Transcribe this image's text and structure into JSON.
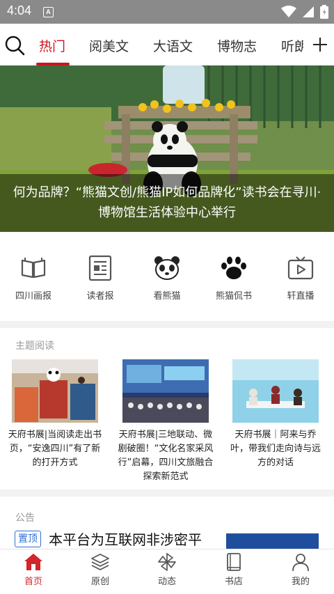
{
  "status_bar": {
    "time": "4:04",
    "notification_letter": "A"
  },
  "top_nav": {
    "tabs": [
      {
        "label": "热门",
        "active": true
      },
      {
        "label": "阅美文"
      },
      {
        "label": "大语文"
      },
      {
        "label": "博物志"
      },
      {
        "label": "听朗"
      }
    ],
    "accent_color": "#c8161d"
  },
  "banner": {
    "caption_line1": "何为品牌？“熊猫文创/熊猫IP如何品牌化”读书会在寻川·",
    "caption_line2": "博物馆生活体验中心举行"
  },
  "quick_links": [
    {
      "label": "四川画报",
      "icon": "open-book-icon"
    },
    {
      "label": "读者报",
      "icon": "newspaper-icon"
    },
    {
      "label": "看熊猫",
      "icon": "panda-face-icon"
    },
    {
      "label": "熊猫侃书",
      "icon": "paw-icon"
    },
    {
      "label": "轩直播",
      "icon": "tv-play-icon"
    }
  ],
  "topic_reading": {
    "title": "主题阅读",
    "cards": [
      {
        "text": "天府书展|当阅读走出书页，“安逸四川”有了新的打开方式"
      },
      {
        "text": "天府书展|三地联动、微剧破圈！“文化名家采风行”启幕，四川文旅融合探索新范式"
      },
      {
        "text": "天府书展｜阿来与乔叶，带我们走向诗与远方的对话"
      }
    ]
  },
  "notice": {
    "title": "公告",
    "badge": "置顶",
    "headline": "本平台为互联网非涉密平"
  },
  "bottom_nav": [
    {
      "label": "首页",
      "icon": "home-icon",
      "active": true
    },
    {
      "label": "原创",
      "icon": "layers-icon"
    },
    {
      "label": "动态",
      "icon": "pinwheel-icon"
    },
    {
      "label": "书店",
      "icon": "book-icon"
    },
    {
      "label": "我的",
      "icon": "user-icon"
    }
  ]
}
